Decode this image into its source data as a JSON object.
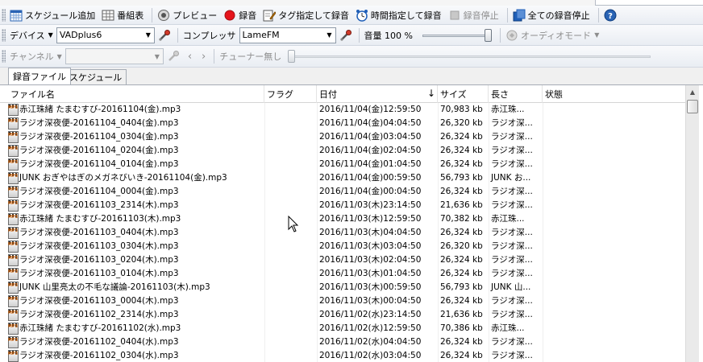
{
  "toolbar1": {
    "add_schedule": "スケジュール追加",
    "program_table": "番組表",
    "preview": "プレビュー",
    "record": "録音",
    "tag_record": "タグ指定して録音",
    "time_record": "時間指定して録音",
    "stop_record": "録音停止",
    "stop_all": "全ての録音停止"
  },
  "toolbar2": {
    "device_label": "デバイス",
    "device_value": "VADplus6",
    "compressor_label": "コンプレッサ",
    "compressor_value": "LameFM",
    "volume_label": "音量 100 %",
    "volume": 100,
    "audio_mode": "オーディオモード"
  },
  "toolbar3": {
    "channel_label": "チャンネル",
    "channel_value": "",
    "tuner_status": "チューナー無し"
  },
  "tabs": [
    {
      "label": "録音ファイル",
      "active": true
    },
    {
      "label": "スケジュール",
      "active": false
    }
  ],
  "columns": {
    "filename": "ファイル名",
    "flag": "フラグ",
    "date": "日付",
    "size": "サイズ",
    "length": "長さ",
    "status": "状態"
  },
  "sort": {
    "column": "date",
    "direction": "descending"
  },
  "rows": [
    {
      "name": "赤江珠緒 たまむすび-20161104(金).mp3",
      "flag": "",
      "date": "2016/11/04(金)12:59:50",
      "size": "70,983 kb",
      "length": "赤江珠...",
      "status": ""
    },
    {
      "name": "ラジオ深夜便-20161104_0404(金).mp3",
      "flag": "",
      "date": "2016/11/04(金)04:04:50",
      "size": "26,320 kb",
      "length": "ラジオ深...",
      "status": ""
    },
    {
      "name": "ラジオ深夜便-20161104_0304(金).mp3",
      "flag": "",
      "date": "2016/11/04(金)03:04:50",
      "size": "26,324 kb",
      "length": "ラジオ深...",
      "status": ""
    },
    {
      "name": "ラジオ深夜便-20161104_0204(金).mp3",
      "flag": "",
      "date": "2016/11/04(金)02:04:50",
      "size": "26,324 kb",
      "length": "ラジオ深...",
      "status": ""
    },
    {
      "name": "ラジオ深夜便-20161104_0104(金).mp3",
      "flag": "",
      "date": "2016/11/04(金)01:04:50",
      "size": "26,324 kb",
      "length": "ラジオ深...",
      "status": ""
    },
    {
      "name": "JUNK おぎやはぎのメガネびいき-20161104(金).mp3",
      "flag": "",
      "date": "2016/11/04(金)00:59:50",
      "size": "56,793 kb",
      "length": "JUNK お...",
      "status": ""
    },
    {
      "name": "ラジオ深夜便-20161104_0004(金).mp3",
      "flag": "",
      "date": "2016/11/04(金)00:04:50",
      "size": "26,324 kb",
      "length": "ラジオ深...",
      "status": ""
    },
    {
      "name": "ラジオ深夜便-20161103_2314(木).mp3",
      "flag": "",
      "date": "2016/11/03(木)23:14:50",
      "size": "21,636 kb",
      "length": "ラジオ深...",
      "status": ""
    },
    {
      "name": "赤江珠緒 たまむすび-20161103(木).mp3",
      "flag": "",
      "date": "2016/11/03(木)12:59:50",
      "size": "70,382 kb",
      "length": "赤江珠...",
      "status": ""
    },
    {
      "name": "ラジオ深夜便-20161103_0404(木).mp3",
      "flag": "",
      "date": "2016/11/03(木)04:04:50",
      "size": "26,324 kb",
      "length": "ラジオ深...",
      "status": ""
    },
    {
      "name": "ラジオ深夜便-20161103_0304(木).mp3",
      "flag": "",
      "date": "2016/11/03(木)03:04:50",
      "size": "26,320 kb",
      "length": "ラジオ深...",
      "status": ""
    },
    {
      "name": "ラジオ深夜便-20161103_0204(木).mp3",
      "flag": "",
      "date": "2016/11/03(木)02:04:50",
      "size": "26,324 kb",
      "length": "ラジオ深...",
      "status": ""
    },
    {
      "name": "ラジオ深夜便-20161103_0104(木).mp3",
      "flag": "",
      "date": "2016/11/03(木)01:04:50",
      "size": "26,324 kb",
      "length": "ラジオ深...",
      "status": ""
    },
    {
      "name": "JUNK 山里亮太の不毛な議論-20161103(木).mp3",
      "flag": "",
      "date": "2016/11/03(木)00:59:50",
      "size": "56,793 kb",
      "length": "JUNK 山...",
      "status": ""
    },
    {
      "name": "ラジオ深夜便-20161103_0004(木).mp3",
      "flag": "",
      "date": "2016/11/03(木)00:04:50",
      "size": "26,324 kb",
      "length": "ラジオ深...",
      "status": ""
    },
    {
      "name": "ラジオ深夜便-20161102_2314(水).mp3",
      "flag": "",
      "date": "2016/11/02(水)23:14:50",
      "size": "21,636 kb",
      "length": "ラジオ深...",
      "status": ""
    },
    {
      "name": "赤江珠緒 たまむすび-20161102(水).mp3",
      "flag": "",
      "date": "2016/11/02(水)12:59:50",
      "size": "70,386 kb",
      "length": "赤江珠...",
      "status": ""
    },
    {
      "name": "ラジオ深夜便-20161102_0404(水).mp3",
      "flag": "",
      "date": "2016/11/02(水)04:04:50",
      "size": "26,324 kb",
      "length": "ラジオ深...",
      "status": ""
    },
    {
      "name": "ラジオ深夜便-20161102_0304(水).mp3",
      "flag": "",
      "date": "2016/11/02(水)03:04:50",
      "size": "26,324 kb",
      "length": "ラジオ深...",
      "status": ""
    }
  ],
  "colors": {
    "record_red": "#e5131b",
    "accent_blue": "#1f5fb8"
  }
}
